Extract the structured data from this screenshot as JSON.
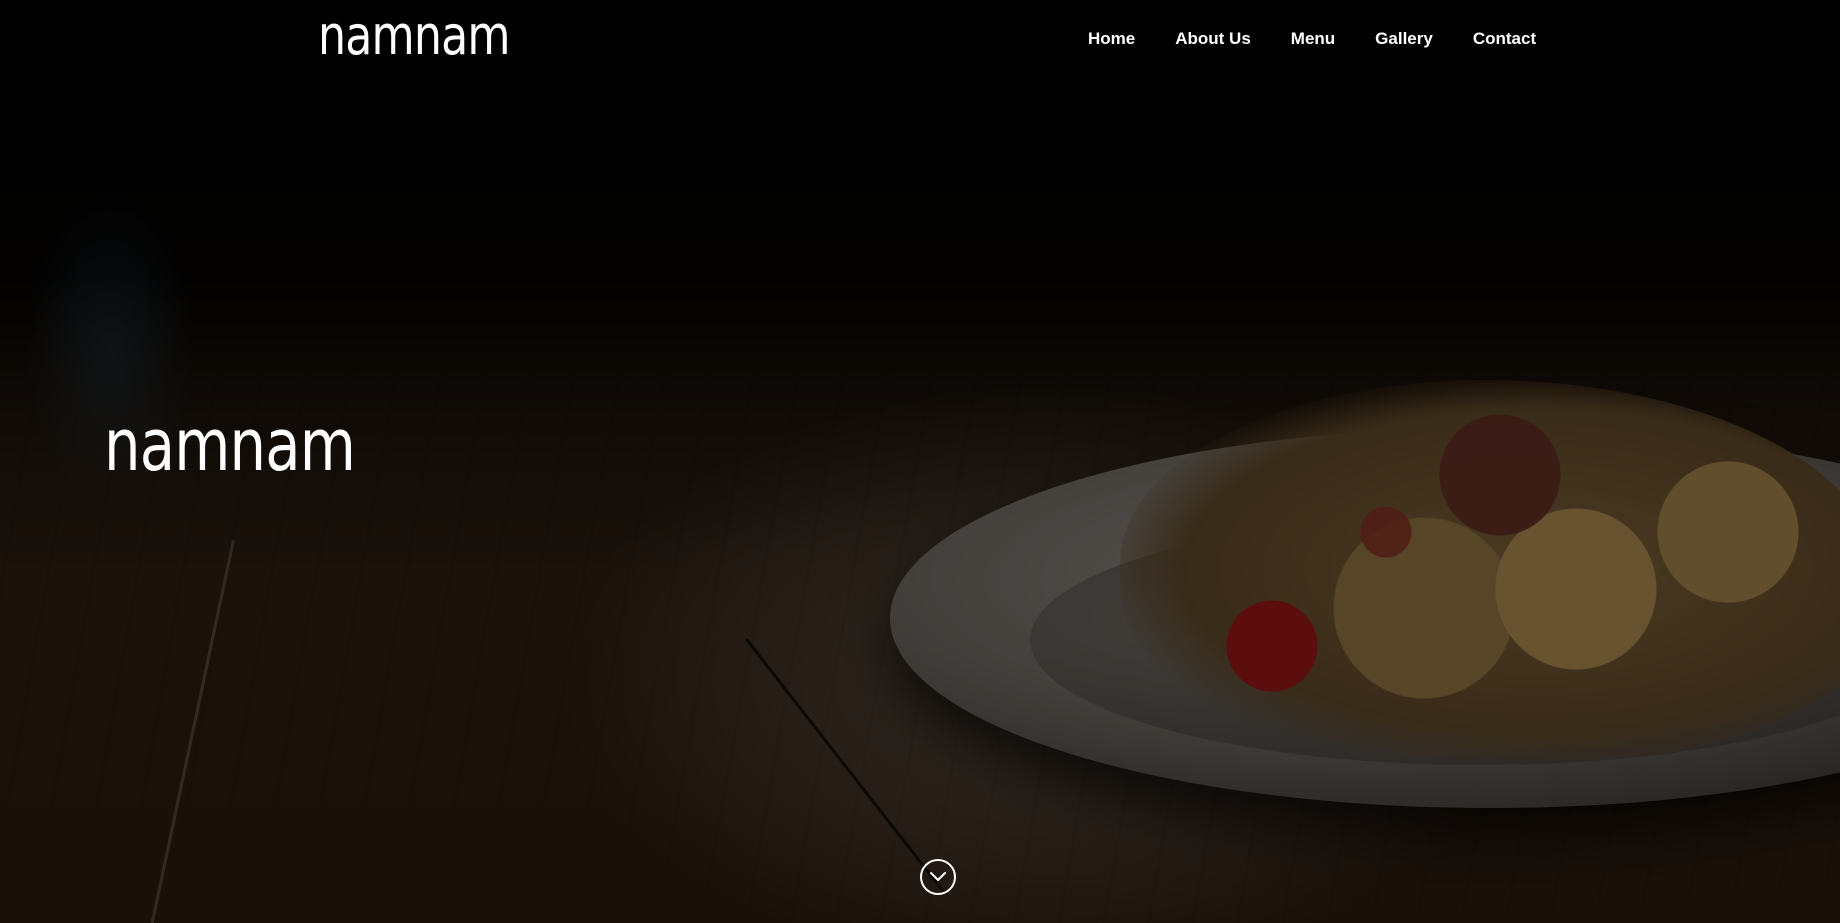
{
  "header": {
    "logo_text": "namnam",
    "nav": [
      {
        "label": "Home"
      },
      {
        "label": "About Us"
      },
      {
        "label": "Menu"
      },
      {
        "label": "Gallery"
      },
      {
        "label": "Contact"
      }
    ]
  },
  "hero": {
    "title": "namnam",
    "background_image": "plate-of-pasta-on-wooden-table",
    "scroll_icon": "chevron-down-circle-icon"
  },
  "colors": {
    "text": "#ffffff",
    "background": "#050403"
  }
}
